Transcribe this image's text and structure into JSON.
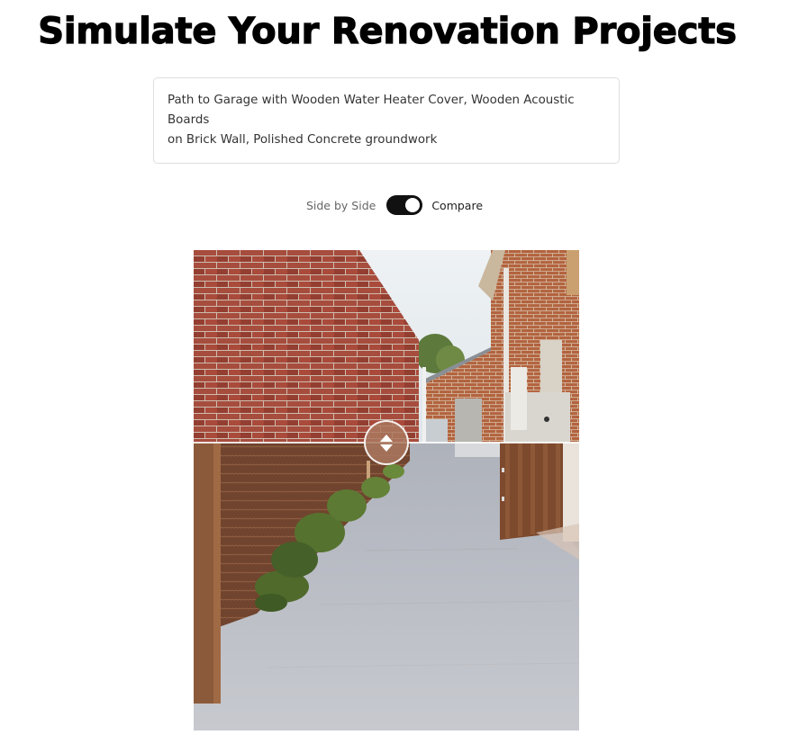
{
  "header": {
    "title": "Simulate Your Renovation Projects"
  },
  "prompt": {
    "line1": "Path to Garage with Wooden Water Heater Cover, Wooden Acoustic Boards",
    "line2": "on Brick Wall, Polished Concrete groundwork"
  },
  "view_toggle": {
    "left_label": "Side by Side",
    "right_label": "Compare",
    "state": "Compare"
  },
  "compare_view": {
    "handle_icon": "up-down-arrows-icon",
    "before_image": "brick-wall-path-original",
    "after_image": "wooden-boards-concrete-path-render"
  },
  "colors": {
    "accent": "#111111",
    "handle": "#aa785f",
    "brick": "#a84a36",
    "wood": "#7a4a2c",
    "concrete": "#c4c6cc"
  }
}
